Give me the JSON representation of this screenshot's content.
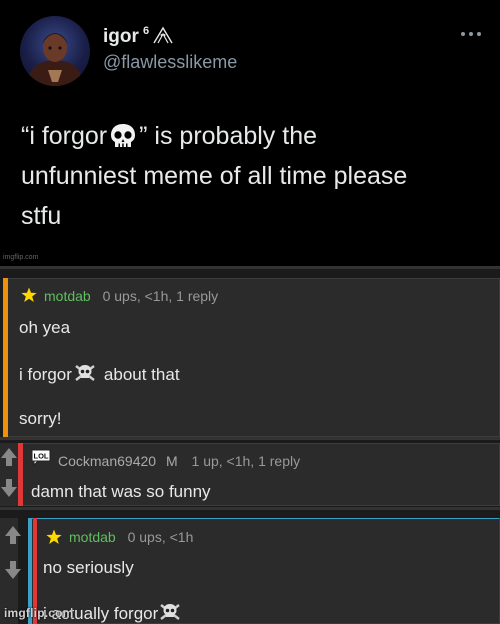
{
  "tweet": {
    "display_name": "igor",
    "name_superscript": "6",
    "handle": "@flawlesslikeme",
    "text_line1_a": "“i forgor",
    "text_line1_b": "” is probably the",
    "text_line2": "unfunniest meme of all time please",
    "text_line3": "stfu",
    "watermark": "imgflip.com",
    "icons": [
      "avatar",
      "ovo-owl-icon",
      "more-options-icon",
      "skull-icon"
    ]
  },
  "comments": [
    {
      "username": "motdab",
      "badge": "star-icon",
      "meta": "0 ups, <1h, 1 reply",
      "lines": [
        "oh yea",
        "i forgor",
        "about that",
        "sorry!"
      ],
      "bar_color": "#f0900a"
    },
    {
      "username": "Cockman69420",
      "badge": "lol-badge-icon",
      "badge_text": "LOL",
      "mod_flag": "M",
      "meta": "1 up, <1h, 1 reply",
      "lines": [
        "damn that was so funny"
      ],
      "bar_color": "#e03838"
    },
    {
      "username": "motdab",
      "badge": "star-icon",
      "meta": "0 ups, <1h",
      "lines": [
        "no seriously",
        "i actually forgor"
      ],
      "bar_color": "#3aa0c8"
    }
  ],
  "watermark": "imgflip.com"
}
